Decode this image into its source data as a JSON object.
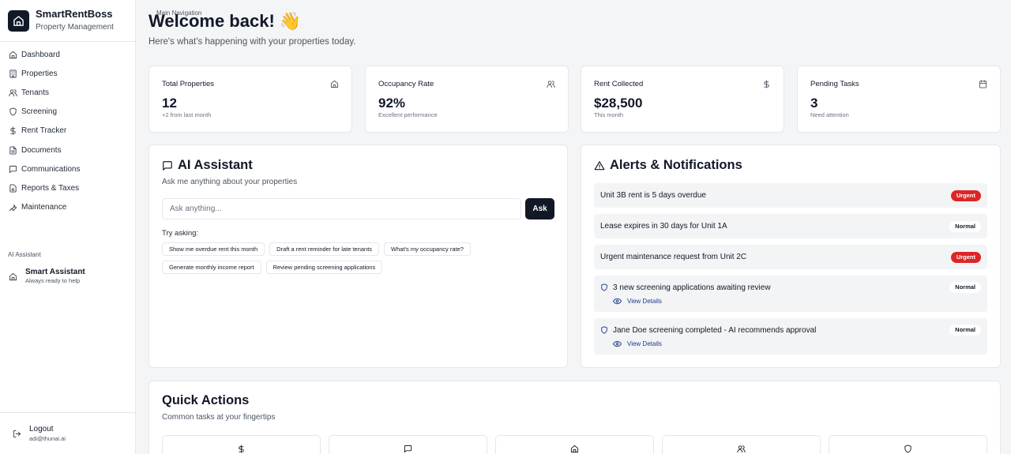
{
  "brand": {
    "name": "SmartRentBoss",
    "subtitle": "Property Management"
  },
  "sidebar": {
    "main_nav_label": "Main Navigation",
    "items": [
      {
        "label": "Dashboard",
        "icon": "home-icon"
      },
      {
        "label": "Properties",
        "icon": "building-icon"
      },
      {
        "label": "Tenants",
        "icon": "users-icon"
      },
      {
        "label": "Screening",
        "icon": "shield-icon"
      },
      {
        "label": "Rent Tracker",
        "icon": "dollar-icon"
      },
      {
        "label": "Documents",
        "icon": "document-icon"
      },
      {
        "label": "Communications",
        "icon": "message-icon"
      },
      {
        "label": "Reports & Taxes",
        "icon": "chart-icon"
      },
      {
        "label": "Maintenance",
        "icon": "wrench-icon"
      }
    ],
    "ai_section_label": "AI Assistant",
    "smart_assistant": {
      "title": "Smart Assistant",
      "subtitle": "Always ready to help"
    },
    "logout": {
      "label": "Logout",
      "email": "adi@thunai.ai"
    }
  },
  "header": {
    "title": "Welcome back! 👋",
    "subtitle": "Here's what's happening with your properties today."
  },
  "stats": [
    {
      "label": "Total Properties",
      "value": "12",
      "note": "+2 from last month",
      "icon": "home-icon"
    },
    {
      "label": "Occupancy Rate",
      "value": "92%",
      "note": "Excellent performance",
      "icon": "users-icon"
    },
    {
      "label": "Rent Collected",
      "value": "$28,500",
      "note": "This month",
      "icon": "dollar-icon"
    },
    {
      "label": "Pending Tasks",
      "value": "3",
      "note": "Need attention",
      "icon": "calendar-icon"
    }
  ],
  "ai_assistant": {
    "title": "AI Assistant",
    "subtitle": "Ask me anything about your properties",
    "input_placeholder": "Ask anything...",
    "ask_label": "Ask",
    "try_label": "Try asking:",
    "suggestions": [
      "Show me overdue rent this month",
      "Draft a rent reminder for late tenants",
      "What's my occupancy rate?",
      "Generate monthly income report",
      "Review pending screening applications"
    ]
  },
  "alerts": {
    "title": "Alerts & Notifications",
    "items": [
      {
        "message": "Unit 3B rent is 5 days overdue",
        "priority": "Urgent"
      },
      {
        "message": "Lease expires in 30 days for Unit 1A",
        "priority": "Normal"
      },
      {
        "message": "Urgent maintenance request from Unit 2C",
        "priority": "Urgent"
      },
      {
        "message": "3 new screening applications awaiting review",
        "priority": "Normal",
        "action": "View Details"
      },
      {
        "message": "Jane Doe screening completed - AI recommends approval",
        "priority": "Normal",
        "action": "View Details"
      }
    ]
  },
  "quick_actions": {
    "title": "Quick Actions",
    "subtitle": "Common tasks at your fingertips",
    "buttons": [
      {
        "icon": "dollar-icon"
      },
      {
        "icon": "message-icon"
      },
      {
        "icon": "home-icon"
      },
      {
        "icon": "users-icon"
      },
      {
        "icon": "shield-icon"
      }
    ]
  },
  "colors": {
    "primary": "#111827",
    "urgent": "#dc2626",
    "link": "#1e3a8a",
    "muted": "#4b5563"
  }
}
